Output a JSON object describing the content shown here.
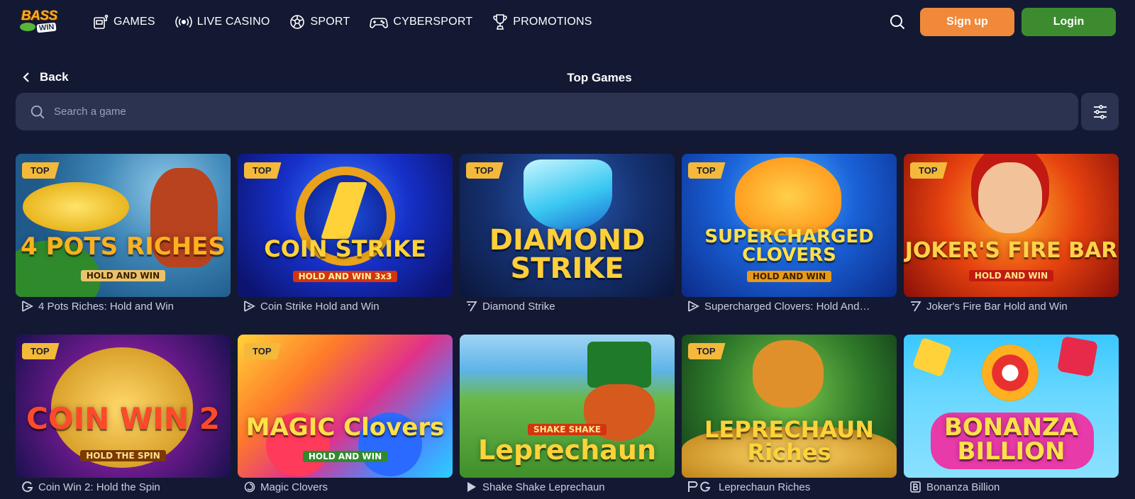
{
  "brand": {
    "line1": "BASS",
    "line2": "WIN"
  },
  "nav": [
    {
      "label": "GAMES",
      "icon": "slot-machine-icon"
    },
    {
      "label": "LIVE CASINO",
      "icon": "broadcast-icon"
    },
    {
      "label": "SPORT",
      "icon": "soccer-ball-icon"
    },
    {
      "label": "CYBERSPORT",
      "icon": "gamepad-icon"
    },
    {
      "label": "PROMOTIONS",
      "icon": "trophy-icon"
    }
  ],
  "header": {
    "signup_label": "Sign up",
    "login_label": "Login"
  },
  "subheader": {
    "back_label": "Back",
    "title": "Top Games"
  },
  "search": {
    "placeholder": "Search a game"
  },
  "colors": {
    "background": "#131933",
    "signup": "#f0893a",
    "login": "#3c8c2f",
    "badge": "#f4b93a",
    "input": "#2b3350"
  },
  "games": [
    {
      "name": "4 Pots Riches: Hold and Win",
      "badge": "TOP",
      "art_title": "4 POTS RICHES",
      "art_sub": "HOLD AND WIN",
      "provider_icon": "play-triangle-icon"
    },
    {
      "name": "Coin Strike Hold and Win",
      "badge": "TOP",
      "art_title": "COIN STRIKE",
      "art_sub": "HOLD AND WIN 3x3",
      "provider_icon": "play-triangle-icon"
    },
    {
      "name": "Diamond Strike",
      "badge": "TOP",
      "art_title": "DIAMOND STRIKE",
      "art_sub": "",
      "provider_icon": "seven-icon"
    },
    {
      "name": "Supercharged Clovers: Hold And…",
      "badge": "TOP",
      "art_title": "SUPERCHARGED CLOVERS",
      "art_sub": "HOLD AND WIN",
      "provider_icon": "play-triangle-icon"
    },
    {
      "name": "Joker's Fire Bar Hold and Win",
      "badge": "TOP",
      "art_title": "JOKER'S FIRE BAR",
      "art_sub": "HOLD AND WIN",
      "provider_icon": "seven-icon"
    },
    {
      "name": "Coin Win 2: Hold the Spin",
      "badge": "TOP",
      "art_title": "COIN WIN 2",
      "art_sub": "HOLD THE SPIN",
      "provider_icon": "g-icon"
    },
    {
      "name": "Magic Clovers",
      "badge": "TOP",
      "art_title": "MAGIC Clovers",
      "art_sub": "HOLD AND WIN",
      "provider_icon": "spiral-icon"
    },
    {
      "name": "Shake Shake Leprechaun",
      "badge": "",
      "art_title": "Leprechaun",
      "art_sub": "SHAKE SHAKE",
      "provider_icon": "play-icon"
    },
    {
      "name": "Leprechaun Riches",
      "badge": "TOP",
      "art_title": "LEPRECHAUN Riches",
      "art_sub": "",
      "provider_icon": "pg-icon"
    },
    {
      "name": "Bonanza Billion",
      "badge": "",
      "art_title": "BONANZA BILLION",
      "art_sub": "",
      "provider_icon": "b-icon"
    }
  ]
}
